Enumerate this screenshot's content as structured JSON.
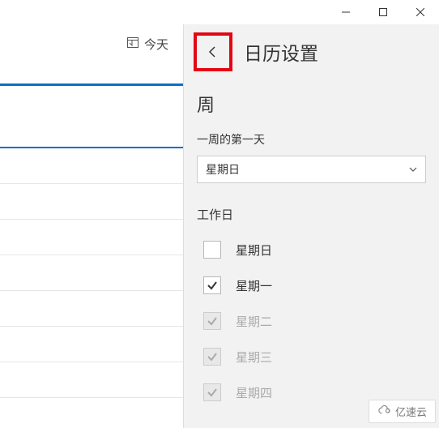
{
  "toolbar": {
    "today_label": "今天"
  },
  "panel": {
    "title": "日历设置",
    "week": {
      "section_title": "周",
      "first_day_label": "一周的第一天",
      "first_day_value": "星期日"
    },
    "workdays": {
      "section_title": "工作日",
      "items": [
        {
          "label": "星期日",
          "checked": false,
          "disabled": false
        },
        {
          "label": "星期一",
          "checked": true,
          "disabled": false
        },
        {
          "label": "星期二",
          "checked": true,
          "disabled": true
        },
        {
          "label": "星期三",
          "checked": true,
          "disabled": true
        },
        {
          "label": "星期四",
          "checked": true,
          "disabled": true
        }
      ]
    }
  },
  "watermark": {
    "text": "亿速云"
  }
}
